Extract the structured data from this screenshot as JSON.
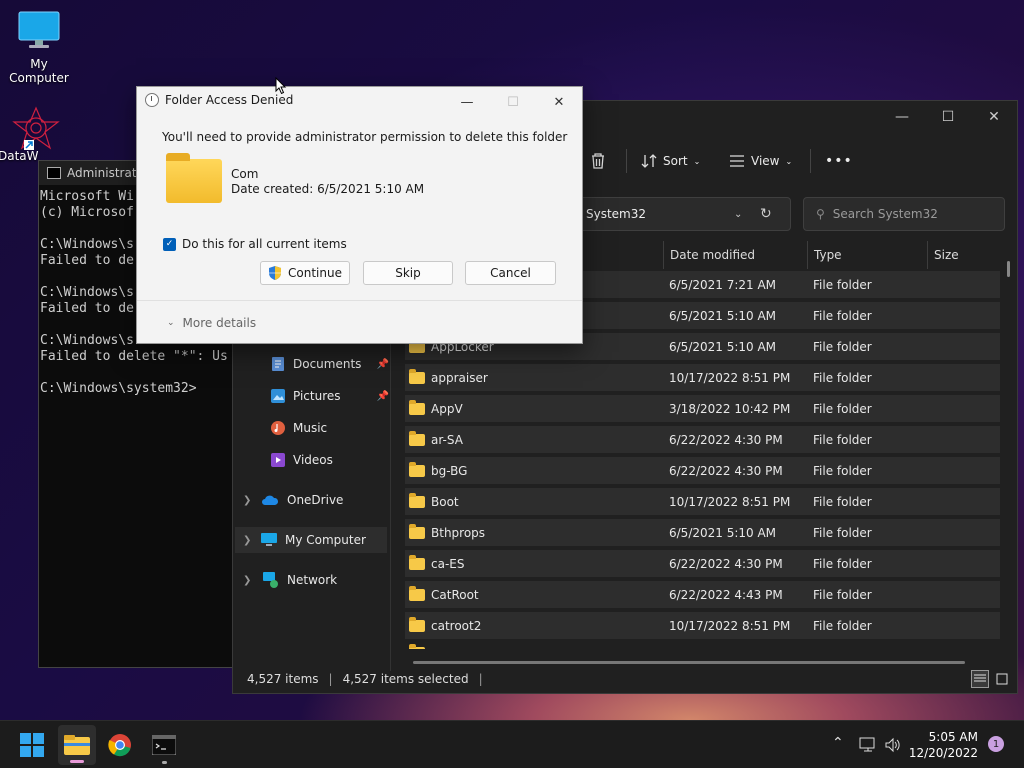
{
  "desktop": {
    "icons": [
      {
        "label": "My Computer"
      },
      {
        "label": "DataW"
      }
    ]
  },
  "console": {
    "title": "Administrato",
    "lines": [
      "Microsoft Wi",
      "(c) Microsof",
      "",
      "C:\\Windows\\s",
      "Failed to de",
      "",
      "C:\\Windows\\s",
      "Failed to de",
      "",
      "C:\\Windows\\s",
      "Failed to delete \"*\": Us",
      "",
      "C:\\Windows\\system32>"
    ]
  },
  "explorer": {
    "toolbar": {
      "sort_label": "Sort",
      "view_label": "View",
      "more_label": "•••"
    },
    "address": "System32",
    "search_placeholder": "Search System32",
    "sidebar": {
      "documents": "Documents",
      "pictures": "Pictures",
      "music": "Music",
      "videos": "Videos",
      "onedrive": "OneDrive",
      "mycomputer": "My Computer",
      "network": "Network"
    },
    "columns": {
      "date": "Date modified",
      "type": "Type",
      "size": "Size"
    },
    "rows": [
      {
        "name": "",
        "date": "6/5/2021 7:21 AM",
        "type": "File folder"
      },
      {
        "name": "",
        "date": "6/5/2021 5:10 AM",
        "type": "File folder"
      },
      {
        "name": "AppLocker",
        "date": "6/5/2021 5:10 AM",
        "type": "File folder"
      },
      {
        "name": "appraiser",
        "date": "10/17/2022 8:51 PM",
        "type": "File folder"
      },
      {
        "name": "AppV",
        "date": "3/18/2022 10:42 PM",
        "type": "File folder"
      },
      {
        "name": "ar-SA",
        "date": "6/22/2022 4:30 PM",
        "type": "File folder"
      },
      {
        "name": "bg-BG",
        "date": "6/22/2022 4:30 PM",
        "type": "File folder"
      },
      {
        "name": "Boot",
        "date": "10/17/2022 8:51 PM",
        "type": "File folder"
      },
      {
        "name": "Bthprops",
        "date": "6/5/2021 5:10 AM",
        "type": "File folder"
      },
      {
        "name": "ca-ES",
        "date": "6/22/2022 4:30 PM",
        "type": "File folder"
      },
      {
        "name": "CatRoot",
        "date": "6/22/2022 4:43 PM",
        "type": "File folder"
      },
      {
        "name": "catroot2",
        "date": "10/17/2022 8:51 PM",
        "type": "File folder"
      }
    ],
    "status": {
      "items": "4,527 items",
      "selected": "4,527 items selected"
    }
  },
  "dialog": {
    "title": "Folder Access Denied",
    "message": "You'll need to provide administrator permission to delete this folder",
    "folder_name": "Com",
    "folder_date": "Date created: 6/5/2021 5:10 AM",
    "checkbox_label": "Do this for all current items",
    "continue_label": "Continue",
    "skip_label": "Skip",
    "cancel_label": "Cancel",
    "more_details": "More details"
  },
  "taskbar": {
    "time": "5:05 AM",
    "date": "12/20/2022",
    "notification_count": "1"
  },
  "colors": {
    "accent": "#005fb8",
    "folder": "#f7c948",
    "explorer_bg": "#202020"
  }
}
